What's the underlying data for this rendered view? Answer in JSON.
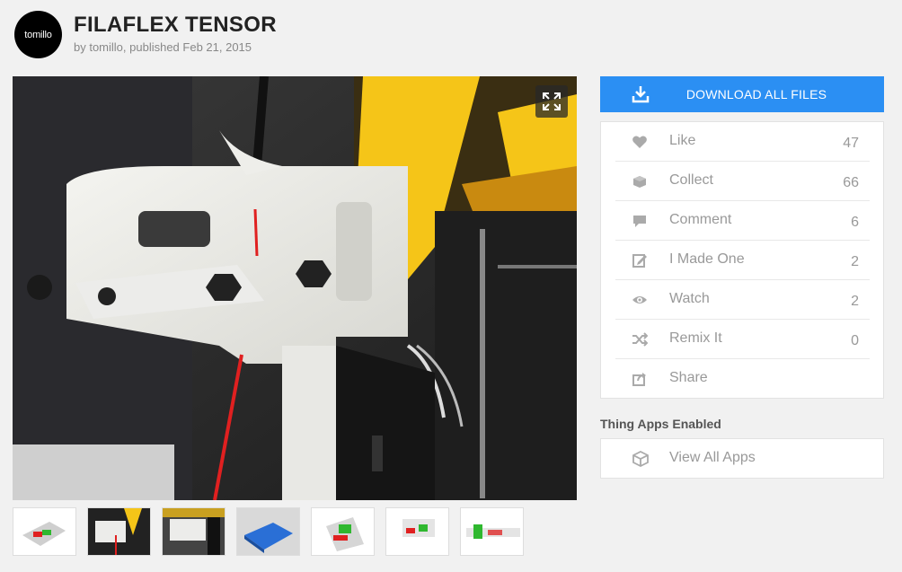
{
  "header": {
    "avatar_text": "tomillo",
    "title": "FILAFLEX TENSOR",
    "byline": "by tomillo, published Feb 21, 2015"
  },
  "download": {
    "label": "DOWNLOAD ALL FILES",
    "icon": "download-icon"
  },
  "actions": [
    {
      "label": "Like",
      "count": "47",
      "icon": "heart-icon"
    },
    {
      "label": "Collect",
      "count": "66",
      "icon": "collect-icon"
    },
    {
      "label": "Comment",
      "count": "6",
      "icon": "comment-icon"
    },
    {
      "label": "I Made One",
      "count": "2",
      "icon": "edit-icon"
    },
    {
      "label": "Watch",
      "count": "2",
      "icon": "eye-icon"
    },
    {
      "label": "Remix It",
      "count": "0",
      "icon": "shuffle-icon"
    },
    {
      "label": "Share",
      "count": "",
      "icon": "share-icon"
    }
  ],
  "apps": {
    "heading": "Thing Apps Enabled",
    "label": "View All Apps",
    "icon": "cube-icon"
  },
  "colors": {
    "accent": "#2b8ff3",
    "filament": "#e02020",
    "frame_yellow": "#f5c518"
  }
}
